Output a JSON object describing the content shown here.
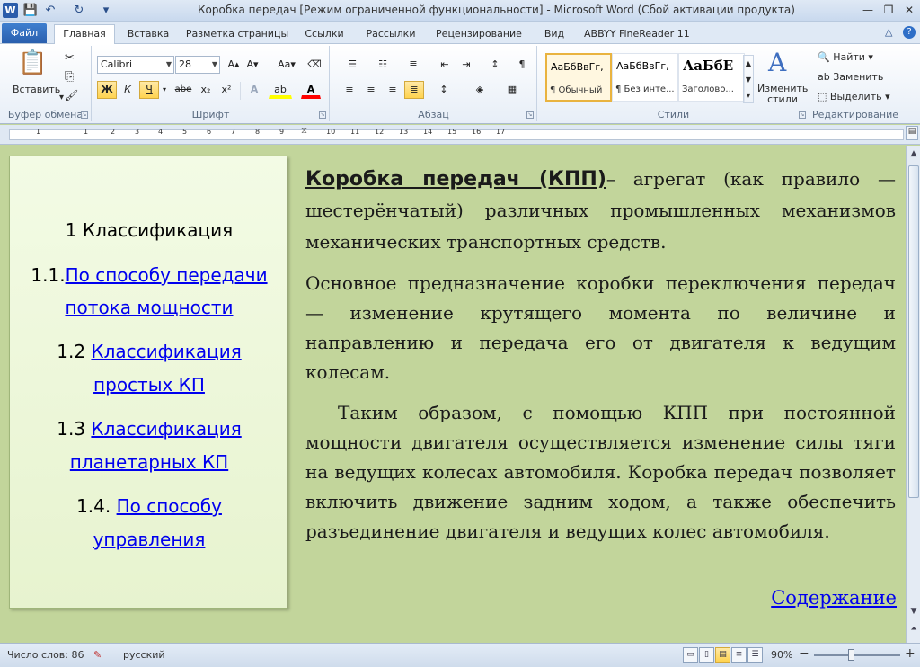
{
  "window": {
    "app_icon": "W",
    "title": "Коробка передач [Режим ограниченной функциональности]  -  Microsoft Word (Сбой активации продукта)",
    "quick_access": {
      "save_icon": "💾",
      "undo_icon": "↶",
      "redo_icon": "↻",
      "customize_icon": "▾"
    },
    "controls": {
      "minimize": "—",
      "maximize": "❐",
      "close": "✕"
    }
  },
  "tabs": {
    "file": "Файл",
    "items": [
      "Главная",
      "Вставка",
      "Разметка страницы",
      "Ссылки",
      "Рассылки",
      "Рецензирование",
      "Вид",
      "ABBYY FineReader 11"
    ],
    "active_index": 0,
    "ribbon_collapse_icon": "△",
    "help_icon": "?"
  },
  "ribbon": {
    "clipboard": {
      "label": "Буфер обмена",
      "paste_label": "Вставить",
      "paste_icon": "📋",
      "cut_icon": "✂",
      "copy_icon": "⎘",
      "format_painter_icon": "🖌"
    },
    "font": {
      "label": "Шрифт",
      "font_name": "Calibri",
      "font_size": "28",
      "grow_icon": "A▴",
      "shrink_icon": "A▾",
      "case_icon": "Aa▾",
      "clear_icon": "⌫",
      "bold": "Ж",
      "italic": "К",
      "underline": "Ч",
      "strike": "abe",
      "subscript": "x₂",
      "superscript": "x²",
      "effects_icon": "A",
      "highlight_icon": "ab",
      "font_color_icon": "A",
      "highlight_color": "#ffff00",
      "font_color": "#ff0000"
    },
    "paragraph": {
      "label": "Абзац",
      "bullets_icon": "☰",
      "numbering_icon": "☷",
      "multilevel_icon": "≣",
      "decrease_indent_icon": "⇤",
      "increase_indent_icon": "⇥",
      "sort_icon": "↕",
      "pilcrow_icon": "¶",
      "align_left_icon": "≡",
      "align_center_icon": "≡",
      "align_right_icon": "≡",
      "justify_icon": "≣",
      "line_spacing_icon": "↕",
      "shading_icon": "◈",
      "borders_icon": "▦"
    },
    "styles": {
      "label": "Стили",
      "items": [
        {
          "sample": "АаБбВвГг,",
          "name": "¶ Обычный"
        },
        {
          "sample": "АаБбВвГг,",
          "name": "¶ Без инте..."
        },
        {
          "sample": "АаБбЕ",
          "name": "Заголово..."
        }
      ],
      "change_styles_label": "Изменить стили",
      "change_styles_icon": "A"
    },
    "editing": {
      "label": "Редактирование",
      "find": "Найти",
      "replace": "Заменить",
      "select": "Выделить"
    }
  },
  "ruler": {
    "numbers": [
      "1",
      "1",
      "2",
      "3",
      "4",
      "5",
      "6",
      "7",
      "8",
      "9",
      "10",
      "11",
      "12",
      "13",
      "14",
      "15",
      "16",
      "17"
    ]
  },
  "document": {
    "toc": {
      "title": "1 Классификация",
      "items": [
        {
          "num": "1.1.",
          "line1": "По способу передачи",
          "line2": "потока мощности"
        },
        {
          "num": "1.2 ",
          "line1": "Классификация",
          "line2": "простых КП"
        },
        {
          "num": "1.3 ",
          "line1": "Классификация",
          "line2": "планетарных КП"
        },
        {
          "num": "1.4. ",
          "line1": "По способу",
          "line2": "управления"
        }
      ]
    },
    "paragraphs": {
      "p1_heading": "Коробка передач (КПП)",
      "p1_rest": "– агрегат (как правило — шестерёнчатый) различных промышленных механизмов механических транспортных средств.",
      "p2": " Основное предназначение коробки переключения передач — изменение крутящего момента по величине и направлению и передача его от двигателя к ведущим колесам.",
      "p3": "Таким образом, с помощью КПП при постоянной мощности двигателя осуществляется изменение силы тяги на ведущих колесах автомобиля. Коробка передач позволяет включить движение задним ходом, а также обеспечить разъединение двигателя и ведущих колес автомобиля."
    },
    "contents_link": "Содержание"
  },
  "statusbar": {
    "word_count": "Число слов: 86",
    "proofing_icon": "✎",
    "language": "русский",
    "zoom": "90%",
    "zoom_out": "−",
    "zoom_in": "+"
  }
}
